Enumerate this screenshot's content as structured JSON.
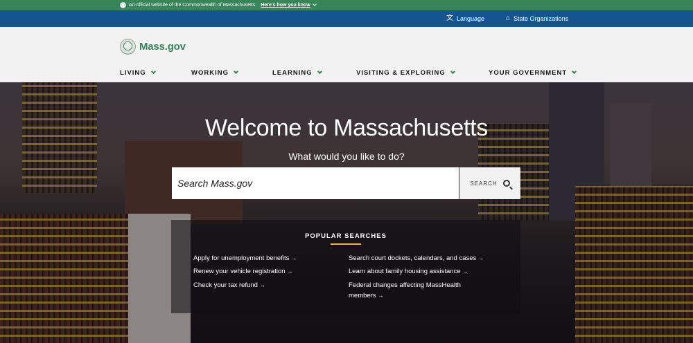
{
  "official_banner": {
    "text": "An official website of the Commonwealth of Massachusetts",
    "link": "Here's how you know"
  },
  "utility_nav": {
    "language": "Language",
    "state_orgs": "State Organizations"
  },
  "header": {
    "logo_text": "Mass.gov",
    "nav": [
      "LIVING",
      "WORKING",
      "LEARNING",
      "VISITING & EXPLORING",
      "YOUR GOVERNMENT"
    ]
  },
  "hero": {
    "title": "Welcome to Massachusetts",
    "subtitle": "What would you like to do?",
    "search_placeholder": "Search Mass.gov",
    "search_button": "SEARCH"
  },
  "popular": {
    "title": "POPULAR SEARCHES",
    "left": [
      "Apply for unemployment benefits",
      "Renew your vehicle registration",
      "Check your tax refund"
    ],
    "right": [
      "Search court dockets, calendars, and cases",
      "Learn about family housing assistance",
      "Federal changes affecting MassHealth",
      "members"
    ]
  },
  "colors": {
    "official_green": "#388557",
    "utility_blue": "#14558f",
    "accent_gold": "#f6b337"
  },
  "icons": [
    "seal-icon",
    "chevron-down-icon",
    "translate-icon",
    "building-icon",
    "search-icon",
    "arrow-right-icon"
  ]
}
